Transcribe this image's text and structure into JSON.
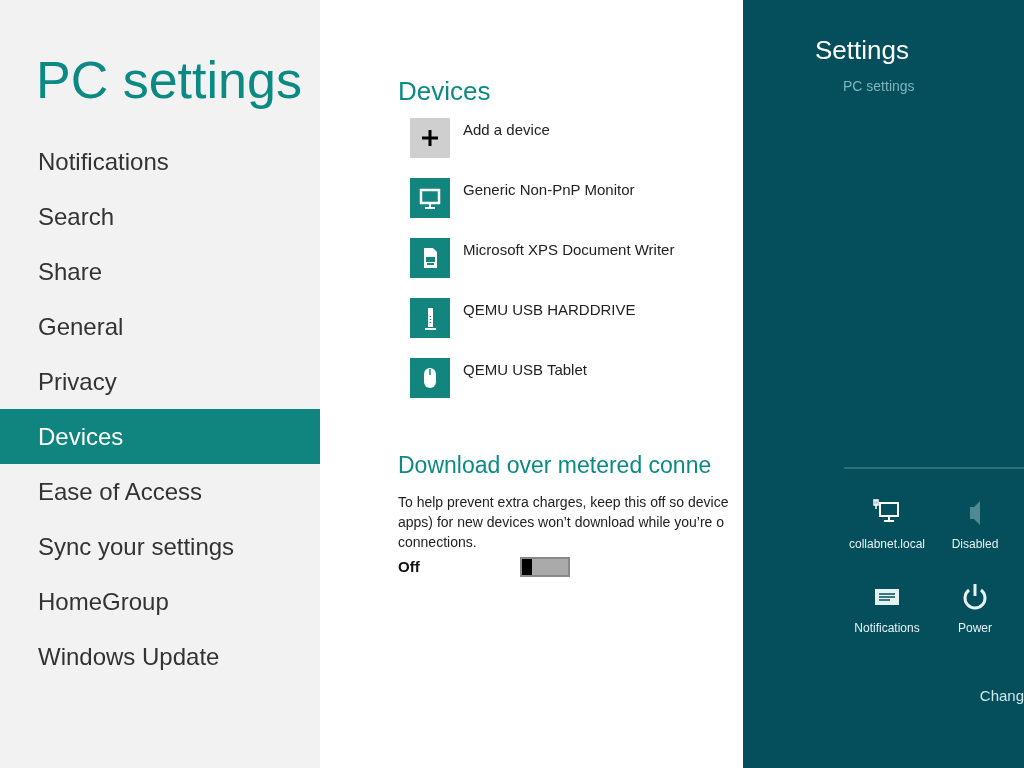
{
  "sidebar": {
    "title": "PC settings",
    "items": [
      {
        "label": "Notifications",
        "selected": false
      },
      {
        "label": "Search",
        "selected": false
      },
      {
        "label": "Share",
        "selected": false
      },
      {
        "label": "General",
        "selected": false
      },
      {
        "label": "Privacy",
        "selected": false
      },
      {
        "label": "Devices",
        "selected": true
      },
      {
        "label": "Ease of Access",
        "selected": false
      },
      {
        "label": "Sync your settings",
        "selected": false
      },
      {
        "label": "HomeGroup",
        "selected": false
      },
      {
        "label": "Windows Update",
        "selected": false
      }
    ]
  },
  "content": {
    "heading": "Devices",
    "devices": [
      {
        "kind": "add",
        "label": "Add a device"
      },
      {
        "kind": "monitor",
        "label": "Generic Non-PnP Monitor"
      },
      {
        "kind": "printer",
        "label": "Microsoft XPS Document Writer"
      },
      {
        "kind": "drive",
        "label": "QEMU USB HARDDRIVE"
      },
      {
        "kind": "mouse",
        "label": "QEMU USB Tablet"
      }
    ],
    "metered": {
      "heading": "Download over metered conne",
      "description": [
        "To help prevent extra charges, keep this off so device",
        "apps) for new devices won’t download while you’re o",
        "connections."
      ],
      "state_label": "Off",
      "on": false
    }
  },
  "charm": {
    "title": "Settings",
    "link": "PC settings",
    "quick": [
      {
        "kind": "network",
        "label": "collabnet.local"
      },
      {
        "kind": "volume",
        "label": "Disabled"
      },
      {
        "kind": "notifications",
        "label": "Notifications"
      },
      {
        "kind": "power",
        "label": "Power"
      }
    ],
    "footer_link": "Chang"
  }
}
